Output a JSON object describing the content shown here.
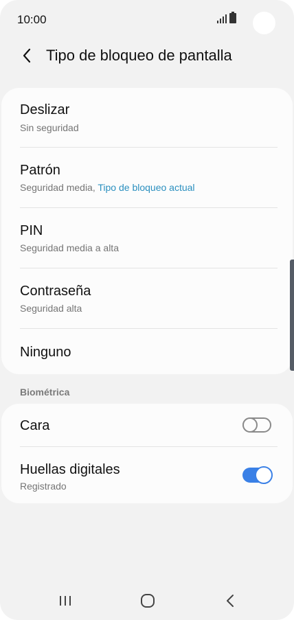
{
  "status_bar": {
    "time": "10:00"
  },
  "header": {
    "title": "Tipo de bloqueo de pantalla"
  },
  "lock_types": [
    {
      "title": "Deslizar",
      "subtitle": "Sin seguridad"
    },
    {
      "title": "Patrón",
      "subtitle": "Seguridad media, ",
      "subtitle_accent": "Tipo de bloqueo actual"
    },
    {
      "title": "PIN",
      "subtitle": "Seguridad media a alta"
    },
    {
      "title": "Contraseña",
      "subtitle": "Seguridad alta"
    },
    {
      "title": "Ninguno"
    }
  ],
  "biometrics": {
    "section_label": "Biométrica",
    "items": [
      {
        "title": "Cara",
        "enabled": false
      },
      {
        "title": "Huellas digitales",
        "subtitle": "Registrado",
        "enabled": true
      }
    ]
  },
  "colors": {
    "accent": "#2a8fbf",
    "toggle_on": "#3a80e6",
    "background": "#f2f2f2"
  }
}
